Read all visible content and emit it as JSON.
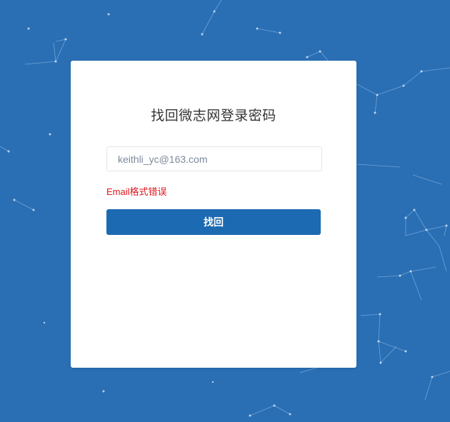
{
  "form": {
    "title": "找回微志网登录密码",
    "email_value": "keithli_yc@163.com",
    "error_message": "Email格式错误",
    "submit_label": "找回"
  },
  "colors": {
    "background": "#2a6fb4",
    "button": "#1c6ab1",
    "error": "#e0161b"
  }
}
